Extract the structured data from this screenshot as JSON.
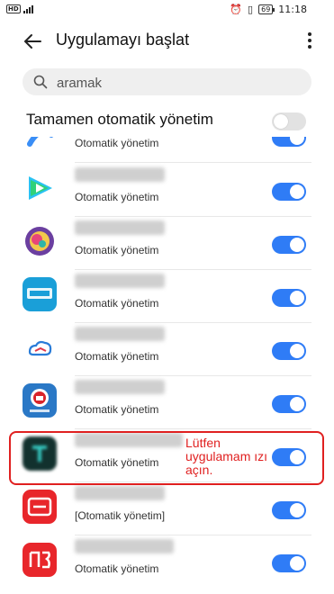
{
  "status": {
    "time": "11:18",
    "battery": "69",
    "network": "HD"
  },
  "header": {
    "title": "Uygulamayı başlat"
  },
  "search": {
    "placeholder": "aramak"
  },
  "master": {
    "label": "Tamamen otomatik yönetim",
    "enabled": false
  },
  "apps": [
    {
      "subtitle": "Otomatik yönetim",
      "enabled": true,
      "icon": "blue-app-icon"
    },
    {
      "subtitle": "Otomatik yönetim",
      "enabled": true,
      "icon": "tencent-video-icon"
    },
    {
      "subtitle": "Otomatik yönetim",
      "enabled": true,
      "icon": "colorful-circle-app-icon"
    },
    {
      "subtitle": "Otomatik yönetim",
      "enabled": true,
      "icon": "tianfutong-icon"
    },
    {
      "subtitle": "Otomatik yönetim",
      "enabled": true,
      "icon": "cloud-app-icon"
    },
    {
      "subtitle": "Otomatik yönetim",
      "enabled": true,
      "icon": "railway-12306-icon"
    },
    {
      "subtitle": "Otomatik yönetim",
      "enabled": true,
      "icon": "total-commander-icon"
    },
    {
      "subtitle": "[Otomatik yönetim]",
      "enabled": true,
      "icon": "youdao-dictionary-icon"
    },
    {
      "subtitle": "Otomatik yönetim",
      "enabled": true,
      "icon": "netease-mail-icon"
    }
  ],
  "annotation": {
    "text": "Lütfen uygulamam ızı açın.",
    "color": "#e02020"
  },
  "colors": {
    "switch_on": "#2f7cf6",
    "switch_off": "#e2e2e2"
  }
}
